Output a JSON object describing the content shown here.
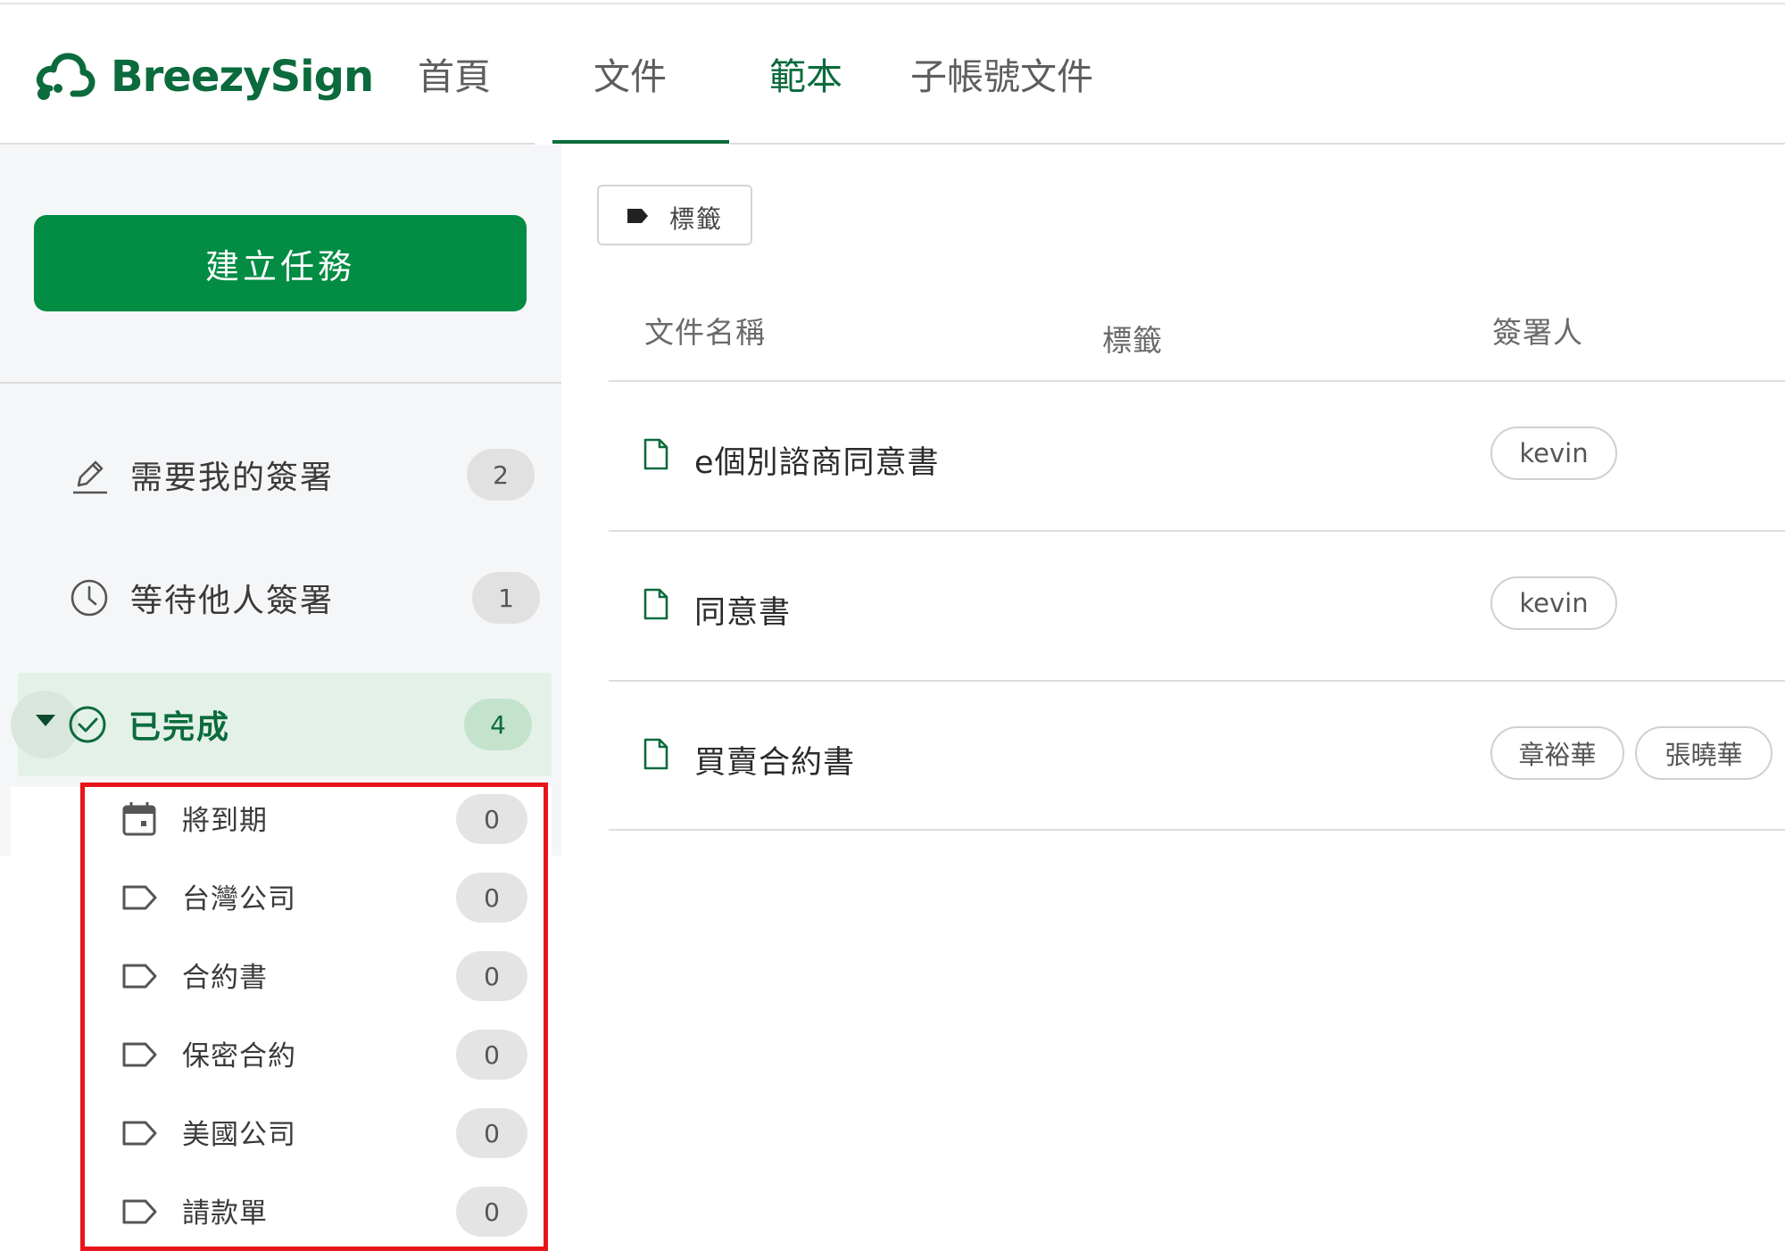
{
  "app": {
    "brand": "BreezySign",
    "brand_color": "#0b6b3c",
    "accent_green": "#028c44"
  },
  "nav": {
    "tabs": [
      {
        "label": "首頁"
      },
      {
        "label": "文件"
      },
      {
        "label": "範本"
      },
      {
        "label": "子帳號文件"
      }
    ],
    "underlined_tab": "文件"
  },
  "sidebar": {
    "create_label": "建立任務",
    "items": [
      {
        "label": "需要我的簽署",
        "count": "2",
        "icon": "pen-icon"
      },
      {
        "label": "等待他人簽署",
        "count": "1",
        "icon": "clock-icon"
      },
      {
        "label": "已完成",
        "count": "4",
        "icon": "check-circle-icon",
        "expanded": true
      }
    ],
    "sub_items": [
      {
        "label": "將到期",
        "count": "0",
        "icon": "calendar-icon"
      },
      {
        "label": "台灣公司",
        "count": "0",
        "icon": "tag-icon"
      },
      {
        "label": "合約書",
        "count": "0",
        "icon": "tag-icon"
      },
      {
        "label": "保密合約",
        "count": "0",
        "icon": "tag-icon"
      },
      {
        "label": "美國公司",
        "count": "0",
        "icon": "tag-icon"
      },
      {
        "label": "請款單",
        "count": "0",
        "icon": "tag-icon"
      }
    ],
    "highlight_color": "#e8141a"
  },
  "toolbar": {
    "tag_button_label": "標籤"
  },
  "table": {
    "columns": [
      "文件名稱",
      "標籤",
      "簽署人"
    ],
    "rows": [
      {
        "name": "e個別諮商同意書",
        "signers": [
          "kevin"
        ]
      },
      {
        "name": "同意書",
        "signers": [
          "kevin"
        ]
      },
      {
        "name": "買賣合約書",
        "signers": [
          "章裕華",
          "張曉華"
        ]
      }
    ]
  }
}
